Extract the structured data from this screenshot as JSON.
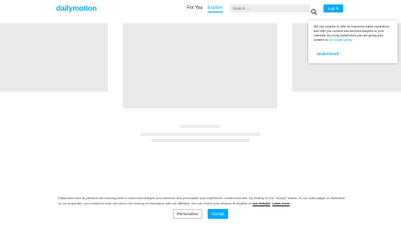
{
  "header": {
    "logo": "dailymotion",
    "nav": [
      {
        "label": "For You",
        "active": false
      },
      {
        "label": "Explore",
        "active": true
      }
    ],
    "search": {
      "placeholder": "Search ..."
    },
    "login_label": "Log in"
  },
  "cookie_popup": {
    "text": "We use cookies to offer an improved online experience and offer you content and services adopted to your interests. By using Dailymotion you are giving your consent to ",
    "link_text": "our cookie policy.",
    "button_label": "Understood"
  },
  "consent_bar": {
    "text_part1": "Dailymotion and its partners use tracking tools to collect and analyze your behavior and personalize your experience, content and ads. By clicking on the \"Accept\" button, on our video player or elsewhere on our properties, you consent to their use and to the sharing of information with our affiliates. You can review your choices at anytime on ",
    "link1": "our website",
    "text_part2": ". ",
    "link2": "Learn more",
    "personalise_label": "Personalise",
    "accept_label": "Accept"
  },
  "colors": {
    "accent": "#00aaff",
    "placeholder": "#e9e9e9"
  }
}
